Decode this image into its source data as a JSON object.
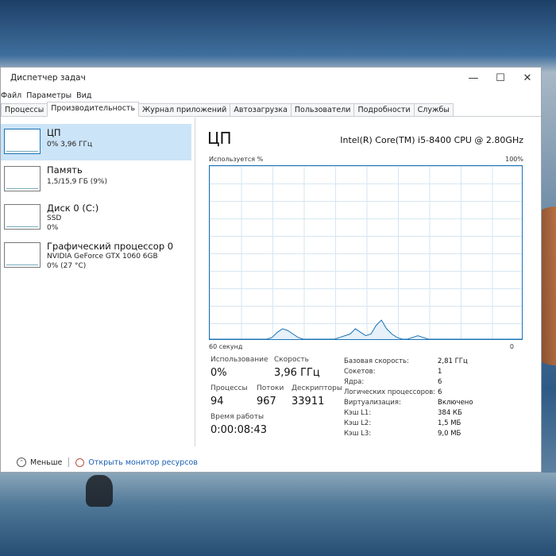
{
  "window": {
    "title": "Диспетчер задач",
    "controls": {
      "minimize": "—",
      "maximize": "☐",
      "close": "✕"
    }
  },
  "menu": [
    "Файл",
    "Параметры",
    "Вид"
  ],
  "tabs": [
    {
      "label": "Процессы"
    },
    {
      "label": "Производительность",
      "active": true
    },
    {
      "label": "Журнал приложений"
    },
    {
      "label": "Автозагрузка"
    },
    {
      "label": "Пользователи"
    },
    {
      "label": "Подробности"
    },
    {
      "label": "Службы"
    }
  ],
  "sidebar": {
    "items": [
      {
        "name": "ЦП",
        "line1": "0%  3,96 ГГц",
        "line2": ""
      },
      {
        "name": "Память",
        "line1": "1,5/15,9 ГБ (9%)",
        "line2": ""
      },
      {
        "name": "Диск 0 (C:)",
        "line1": "SSD",
        "line2": "0%"
      },
      {
        "name": "Графический процессор 0",
        "line1": "NVIDIA GeForce GTX 1060 6GB",
        "line2": "0%  (27 °C)"
      }
    ]
  },
  "main": {
    "title": "ЦП",
    "model": "Intel(R) Core(TM) i5-8400 CPU @ 2.80GHz",
    "graph": {
      "y_label": "Используется %",
      "y_max_label": "100%",
      "x_left_label": "60 секунд",
      "x_right_label": "0"
    },
    "stats": {
      "usage_label": "Использование",
      "usage_value": "0%",
      "speed_label": "Скорость",
      "speed_value": "3,96 ГГц",
      "processes_label": "Процессы",
      "processes_value": "94",
      "threads_label": "Потоки",
      "threads_value": "967",
      "handles_label": "Дескрипторы",
      "handles_value": "33911",
      "uptime_label": "Время работы",
      "uptime_value": "0:00:08:43"
    },
    "specs": [
      {
        "label": "Базовая скорость:",
        "value": "2,81 ГГц"
      },
      {
        "label": "Сокетов:",
        "value": "1"
      },
      {
        "label": "Ядра:",
        "value": "6"
      },
      {
        "label": "Логических процессоров:",
        "value": "6"
      },
      {
        "label": "Виртуализация:",
        "value": "Включено"
      },
      {
        "label": "Кэш L1:",
        "value": "384 КБ"
      },
      {
        "label": "Кэш L2:",
        "value": "1,5 МБ"
      },
      {
        "label": "Кэш L3:",
        "value": "9,0 МБ"
      }
    ]
  },
  "footer": {
    "fewer_label": "Меньше",
    "monitor_link": "Открыть монитор ресурсов"
  },
  "colors": {
    "accent": "#1a73b5",
    "selected": "#cce4f7",
    "link": "#1a5fb4"
  },
  "cpu_history": [
    0,
    0,
    0,
    0,
    0,
    0,
    0,
    0,
    0,
    0,
    0,
    0,
    1,
    4,
    6,
    5,
    3,
    1,
    0,
    0,
    0,
    0,
    0,
    0,
    0,
    1,
    2,
    3,
    6,
    4,
    2,
    3,
    8,
    11,
    6,
    3,
    1,
    0,
    0,
    1,
    2,
    1,
    0,
    0,
    0,
    0,
    0,
    0,
    0,
    0,
    0,
    0,
    0,
    0,
    0,
    0,
    0,
    0,
    0,
    0,
    0
  ]
}
